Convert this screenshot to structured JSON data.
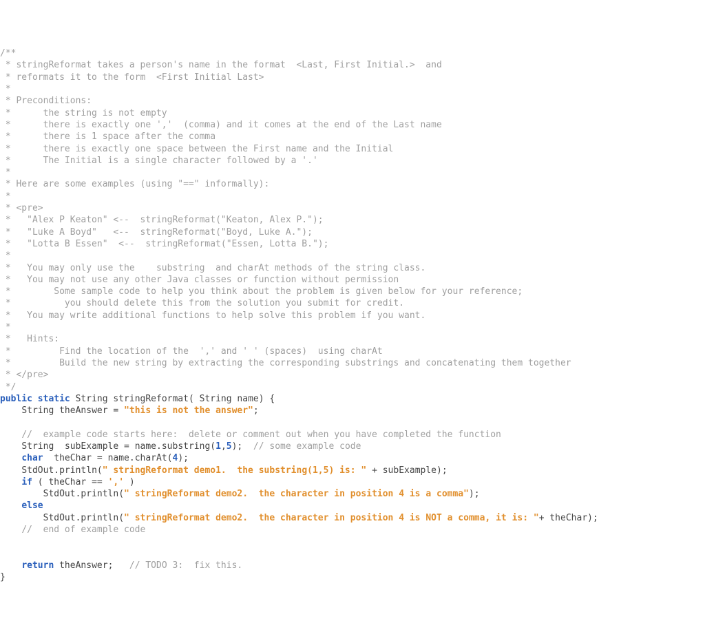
{
  "code": {
    "lines": [
      {
        "segments": [
          {
            "cls": "comment",
            "t": "/**"
          }
        ]
      },
      {
        "segments": [
          {
            "cls": "comment",
            "t": " * stringReformat takes a person's name in the format  <Last, First Initial.>  and"
          }
        ]
      },
      {
        "segments": [
          {
            "cls": "comment",
            "t": " * reformats it to the form  <First Initial Last>"
          }
        ]
      },
      {
        "segments": [
          {
            "cls": "comment",
            "t": " *"
          }
        ]
      },
      {
        "segments": [
          {
            "cls": "comment",
            "t": " * Preconditions:"
          }
        ]
      },
      {
        "segments": [
          {
            "cls": "comment",
            "t": " *      the string is not empty"
          }
        ]
      },
      {
        "segments": [
          {
            "cls": "comment",
            "t": " *      there is exactly one ','  (comma) and it comes at the end of the Last name"
          }
        ]
      },
      {
        "segments": [
          {
            "cls": "comment",
            "t": " *      there is 1 space after the comma"
          }
        ]
      },
      {
        "segments": [
          {
            "cls": "comment",
            "t": " *      there is exactly one space between the First name and the Initial"
          }
        ]
      },
      {
        "segments": [
          {
            "cls": "comment",
            "t": " *      The Initial is a single character followed by a '.'"
          }
        ]
      },
      {
        "segments": [
          {
            "cls": "comment",
            "t": " *"
          }
        ]
      },
      {
        "segments": [
          {
            "cls": "comment",
            "t": " * Here are some examples (using \"==\" informally):"
          }
        ]
      },
      {
        "segments": [
          {
            "cls": "comment",
            "t": " *"
          }
        ]
      },
      {
        "segments": [
          {
            "cls": "comment",
            "t": " * <pre>"
          }
        ]
      },
      {
        "segments": [
          {
            "cls": "comment",
            "t": " *   \"Alex P Keaton\" <--  stringReformat(\"Keaton, Alex P.\");"
          }
        ]
      },
      {
        "segments": [
          {
            "cls": "comment",
            "t": " *   \"Luke A Boyd\"   <--  stringReformat(\"Boyd, Luke A.\");"
          }
        ]
      },
      {
        "segments": [
          {
            "cls": "comment",
            "t": " *   \"Lotta B Essen\"  <--  stringReformat(\"Essen, Lotta B.\");"
          }
        ]
      },
      {
        "segments": [
          {
            "cls": "comment",
            "t": " *"
          }
        ]
      },
      {
        "segments": [
          {
            "cls": "comment",
            "t": " *   You may only use the    substring  and charAt methods of the string class."
          }
        ]
      },
      {
        "segments": [
          {
            "cls": "comment",
            "t": " *   You may not use any other Java classes or function without permission"
          }
        ]
      },
      {
        "segments": [
          {
            "cls": "comment",
            "t": " *        Some sample code to help you think about the problem is given below for your reference;"
          }
        ]
      },
      {
        "segments": [
          {
            "cls": "comment",
            "t": " *          you should delete this from the solution you submit for credit."
          }
        ]
      },
      {
        "segments": [
          {
            "cls": "comment",
            "t": " *   You may write additional functions to help solve this problem if you want."
          }
        ]
      },
      {
        "segments": [
          {
            "cls": "comment",
            "t": " *"
          }
        ]
      },
      {
        "segments": [
          {
            "cls": "comment",
            "t": " *   Hints:"
          }
        ]
      },
      {
        "segments": [
          {
            "cls": "comment",
            "t": " *         Find the location of the  ',' and ' ' (spaces)  using charAt"
          }
        ]
      },
      {
        "segments": [
          {
            "cls": "comment",
            "t": " *         Build the new string by extracting the corresponding substrings and concatenating them together"
          }
        ]
      },
      {
        "segments": [
          {
            "cls": "comment",
            "t": " * </pre>"
          }
        ]
      },
      {
        "segments": [
          {
            "cls": "comment",
            "t": " */"
          }
        ]
      },
      {
        "segments": [
          {
            "cls": "keyword",
            "t": "public"
          },
          {
            "cls": "punct",
            "t": " "
          },
          {
            "cls": "keyword",
            "t": "static"
          },
          {
            "cls": "punct",
            "t": " "
          },
          {
            "cls": "type",
            "t": "String"
          },
          {
            "cls": "punct",
            "t": " "
          },
          {
            "cls": "ident",
            "t": "stringReformat"
          },
          {
            "cls": "punct",
            "t": "( "
          },
          {
            "cls": "type",
            "t": "String"
          },
          {
            "cls": "punct",
            "t": " "
          },
          {
            "cls": "ident",
            "t": "name"
          },
          {
            "cls": "punct",
            "t": ") {"
          }
        ]
      },
      {
        "segments": [
          {
            "cls": "punct",
            "t": "    "
          },
          {
            "cls": "type",
            "t": "String"
          },
          {
            "cls": "punct",
            "t": " "
          },
          {
            "cls": "ident",
            "t": "theAnswer"
          },
          {
            "cls": "punct",
            "t": " = "
          },
          {
            "cls": "string",
            "t": "\"this is not the answer\""
          },
          {
            "cls": "punct",
            "t": ";"
          }
        ]
      },
      {
        "segments": [
          {
            "cls": "punct",
            "t": ""
          }
        ]
      },
      {
        "segments": [
          {
            "cls": "punct",
            "t": "    "
          },
          {
            "cls": "comment",
            "t": "//  example code starts here:  delete or comment out when you have completed the function"
          }
        ]
      },
      {
        "segments": [
          {
            "cls": "punct",
            "t": "    "
          },
          {
            "cls": "type",
            "t": "String"
          },
          {
            "cls": "punct",
            "t": "  "
          },
          {
            "cls": "ident",
            "t": "subExample"
          },
          {
            "cls": "punct",
            "t": " = "
          },
          {
            "cls": "ident",
            "t": "name"
          },
          {
            "cls": "punct",
            "t": "."
          },
          {
            "cls": "ident",
            "t": "substring"
          },
          {
            "cls": "punct",
            "t": "("
          },
          {
            "cls": "number",
            "t": "1"
          },
          {
            "cls": "punct",
            "t": ","
          },
          {
            "cls": "number",
            "t": "5"
          },
          {
            "cls": "punct",
            "t": ");  "
          },
          {
            "cls": "comment",
            "t": "// some example code"
          }
        ]
      },
      {
        "segments": [
          {
            "cls": "punct",
            "t": "    "
          },
          {
            "cls": "keyword",
            "t": "char"
          },
          {
            "cls": "punct",
            "t": "  "
          },
          {
            "cls": "ident",
            "t": "theChar"
          },
          {
            "cls": "punct",
            "t": " = "
          },
          {
            "cls": "ident",
            "t": "name"
          },
          {
            "cls": "punct",
            "t": "."
          },
          {
            "cls": "ident",
            "t": "charAt"
          },
          {
            "cls": "punct",
            "t": "("
          },
          {
            "cls": "number",
            "t": "4"
          },
          {
            "cls": "punct",
            "t": ");"
          }
        ]
      },
      {
        "segments": [
          {
            "cls": "punct",
            "t": "    "
          },
          {
            "cls": "ident",
            "t": "StdOut"
          },
          {
            "cls": "punct",
            "t": "."
          },
          {
            "cls": "ident",
            "t": "println"
          },
          {
            "cls": "punct",
            "t": "("
          },
          {
            "cls": "string",
            "t": "\" stringReformat demo1.  the substring(1,5) is: \""
          },
          {
            "cls": "punct",
            "t": " + "
          },
          {
            "cls": "ident",
            "t": "subExample"
          },
          {
            "cls": "punct",
            "t": ");"
          }
        ]
      },
      {
        "segments": [
          {
            "cls": "punct",
            "t": "    "
          },
          {
            "cls": "keyword",
            "t": "if"
          },
          {
            "cls": "punct",
            "t": " ( "
          },
          {
            "cls": "ident",
            "t": "theChar"
          },
          {
            "cls": "punct",
            "t": " == "
          },
          {
            "cls": "string",
            "t": "','"
          },
          {
            "cls": "punct",
            "t": " )"
          }
        ]
      },
      {
        "segments": [
          {
            "cls": "punct",
            "t": "        "
          },
          {
            "cls": "ident",
            "t": "StdOut"
          },
          {
            "cls": "punct",
            "t": "."
          },
          {
            "cls": "ident",
            "t": "println"
          },
          {
            "cls": "punct",
            "t": "("
          },
          {
            "cls": "string",
            "t": "\" stringReformat demo2.  the character in position 4 is a comma\""
          },
          {
            "cls": "punct",
            "t": ");"
          }
        ]
      },
      {
        "segments": [
          {
            "cls": "punct",
            "t": "    "
          },
          {
            "cls": "keyword",
            "t": "else"
          }
        ]
      },
      {
        "segments": [
          {
            "cls": "punct",
            "t": "        "
          },
          {
            "cls": "ident",
            "t": "StdOut"
          },
          {
            "cls": "punct",
            "t": "."
          },
          {
            "cls": "ident",
            "t": "println"
          },
          {
            "cls": "punct",
            "t": "("
          },
          {
            "cls": "string",
            "t": "\" stringReformat demo2.  the character in position 4 is NOT a comma, it is: \""
          },
          {
            "cls": "punct",
            "t": "+ "
          },
          {
            "cls": "ident",
            "t": "theChar"
          },
          {
            "cls": "punct",
            "t": ");"
          }
        ]
      },
      {
        "segments": [
          {
            "cls": "punct",
            "t": "    "
          },
          {
            "cls": "comment",
            "t": "//  end of example code"
          }
        ]
      },
      {
        "segments": [
          {
            "cls": "punct",
            "t": ""
          }
        ]
      },
      {
        "segments": [
          {
            "cls": "punct",
            "t": ""
          }
        ]
      },
      {
        "segments": [
          {
            "cls": "punct",
            "t": "    "
          },
          {
            "cls": "keyword",
            "t": "return"
          },
          {
            "cls": "punct",
            "t": " "
          },
          {
            "cls": "ident",
            "t": "theAnswer"
          },
          {
            "cls": "punct",
            "t": ";   "
          },
          {
            "cls": "comment",
            "t": "// TODO 3:  fix this."
          }
        ]
      },
      {
        "segments": [
          {
            "cls": "punct",
            "t": "}"
          }
        ]
      }
    ]
  }
}
